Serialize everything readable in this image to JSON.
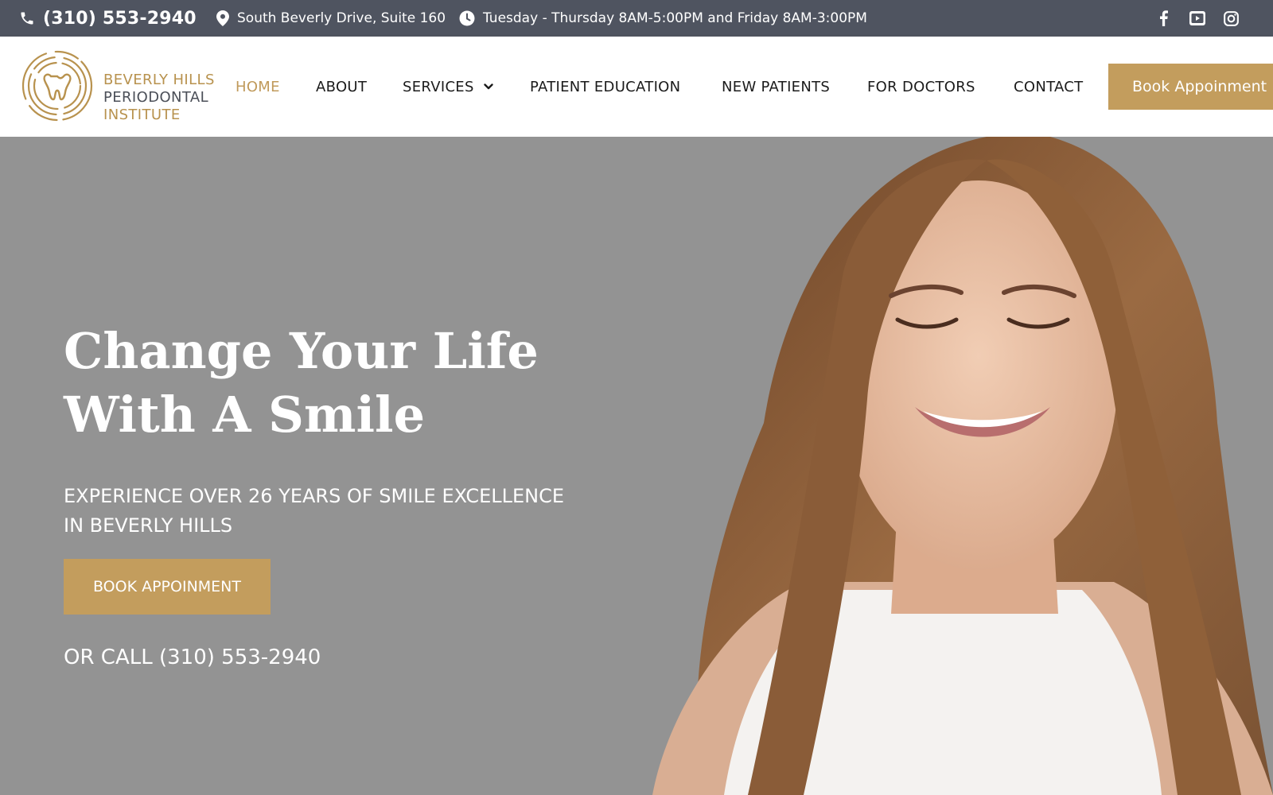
{
  "topbar": {
    "phone": "(310) 553-2940",
    "address": "South Beverly Drive, Suite 160",
    "hours": "Tuesday - Thursday 8AM-5:00PM and Friday 8AM-3:00PM",
    "icons": {
      "phone": "phone-icon",
      "address": "map-pin-icon",
      "hours": "clock-icon",
      "social": [
        "facebook-icon",
        "youtube-icon",
        "instagram-icon"
      ]
    }
  },
  "logo": {
    "line1": "BEVERLY HILLS",
    "line2": "PERIODONTAL",
    "line3": "INSTITUTE"
  },
  "nav": {
    "items": [
      {
        "label": "HOME",
        "active": true
      },
      {
        "label": "ABOUT"
      },
      {
        "label": "SERVICES",
        "has_dropdown": true
      },
      {
        "label": "PATIENT EDUCATION"
      },
      {
        "label": "NEW PATIENTS"
      },
      {
        "label": "FOR DOCTORS"
      },
      {
        "label": "CONTACT"
      }
    ],
    "cta": "Book Appoinment"
  },
  "hero": {
    "title_line1": "Change Your Life",
    "title_line2": "With A Smile",
    "subtitle_line1": "EXPERIENCE OVER 26 YEARS OF SMILE EXCELLENCE",
    "subtitle_line2": "IN BEVERLY HILLS",
    "button": "BOOK APPOINMENT",
    "call": "OR CALL (310) 553-2940"
  },
  "colors": {
    "topbar_bg": "#4f5460",
    "accent_gold": "#c39d5d",
    "nav_active": "#c09a5b",
    "hero_bg": "#939393"
  }
}
